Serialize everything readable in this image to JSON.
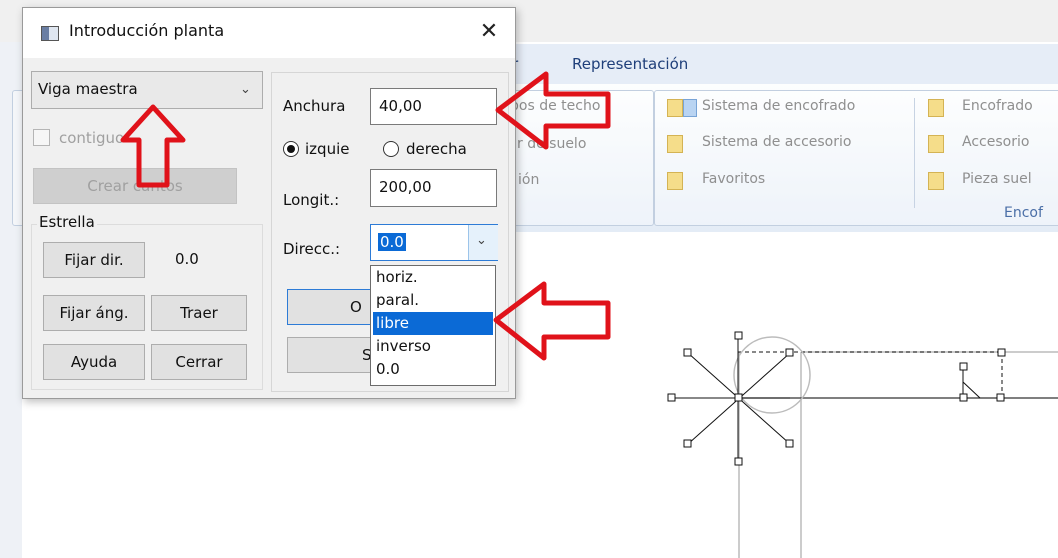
{
  "ribbon": {
    "tab_partial": "r",
    "tab_representacion": "Representación",
    "col1": [
      "pos de techo",
      "r de suelo",
      "ión"
    ],
    "col2": [
      "Sistema de encofrado",
      "Sistema de accesorio",
      "Favoritos"
    ],
    "col3": [
      "Encofrado",
      "Accesorio",
      "Pieza suel"
    ],
    "group_label": "Encof"
  },
  "dialog": {
    "title": "Introducción planta",
    "close_glyph": "✕",
    "type_combo": "Viga maestra",
    "continuous_label": "contiguo",
    "create_button": "Crear cantos",
    "star_group": "Estrella",
    "fix_dir_button": "Fijar dir.",
    "dir_value": "0.0",
    "fix_angle_button": "Fijar áng.",
    "bring_button": "Traer",
    "help_button": "Ayuda",
    "close_button": "Cerrar",
    "width_label": "Anchura",
    "width_value": "40,00",
    "radio_left": "izquie",
    "radio_right": "derecha",
    "radio_selected": "izquie",
    "length_label": "Longit.:",
    "length_value": "200,00",
    "direction_label": "Direcc.:",
    "direction_value": "0.0",
    "hidden_button_1": "O",
    "hidden_button_2": "S",
    "direction_options": [
      "horiz.",
      "paral.",
      "libre",
      "inverso",
      "0.0"
    ],
    "direction_highlighted": "libre"
  },
  "colors": {
    "arrow_red": "#e0121a",
    "selection_blue": "#0b6ad6",
    "ribbon_tab_text": "#1f3f7a"
  }
}
